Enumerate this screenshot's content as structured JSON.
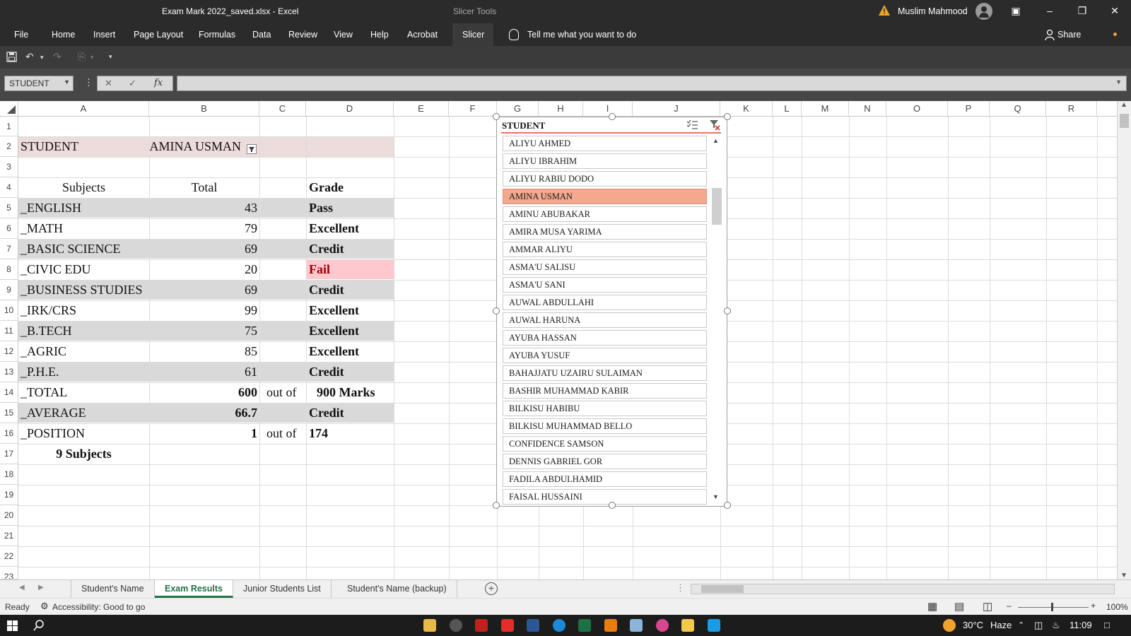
{
  "window": {
    "title": "Exam Mark 2022_saved.xlsx  -  Excel",
    "contextual_tab_group": "Slicer Tools",
    "user": "Muslim Mahmood"
  },
  "ribbon": {
    "tabs": [
      "File",
      "Home",
      "Insert",
      "Page Layout",
      "Formulas",
      "Data",
      "Review",
      "View",
      "Help",
      "Acrobat",
      "Slicer"
    ],
    "tell_me": "Tell me what you want to do",
    "share": "Share"
  },
  "formula_bar": {
    "name_box": "STUDENT",
    "fx": "fx",
    "value": ""
  },
  "columns": [
    "A",
    "B",
    "C",
    "D",
    "E",
    "F",
    "G",
    "H",
    "I",
    "J",
    "K",
    "L",
    "M",
    "N",
    "O",
    "P",
    "Q",
    "R"
  ],
  "rows": [
    "1",
    "2",
    "3",
    "4",
    "5",
    "6",
    "7",
    "8",
    "9",
    "10",
    "11",
    "12",
    "13",
    "14",
    "15",
    "16",
    "17",
    "18",
    "19",
    "20",
    "21",
    "22",
    "23"
  ],
  "sheet": {
    "student_label": "STUDENT",
    "student_name": "AMINA USMAN",
    "headers": {
      "subjects": "Subjects",
      "total": "Total",
      "grade": "Grade"
    },
    "subjects": [
      {
        "name": "_ENGLISH",
        "total": "43",
        "grade": "Pass"
      },
      {
        "name": "_MATH",
        "total": "79",
        "grade": "Excellent"
      },
      {
        "name": "_BASIC SCIENCE",
        "total": "69",
        "grade": "Credit"
      },
      {
        "name": "_CIVIC EDU",
        "total": "20",
        "grade": "Fail"
      },
      {
        "name": "_BUSINESS STUDIES",
        "total": "69",
        "grade": "Credit"
      },
      {
        "name": "_IRK/CRS",
        "total": "99",
        "grade": "Excellent"
      },
      {
        "name": "_B.TECH",
        "total": "75",
        "grade": "Excellent"
      },
      {
        "name": "_AGRIC",
        "total": "85",
        "grade": "Excellent"
      },
      {
        "name": "_P.H.E.",
        "total": "61",
        "grade": "Credit"
      }
    ],
    "total": {
      "label": "_TOTAL",
      "value": "600",
      "out_of": "out of",
      "max": "900 Marks"
    },
    "average": {
      "label": "_AVERAGE",
      "value": "66.7",
      "grade": "Credit"
    },
    "position": {
      "label": "_POSITION",
      "value": "1",
      "out_of": "out of",
      "count": "174"
    },
    "subject_count": "9 Subjects"
  },
  "slicer": {
    "title": "STUDENT",
    "items": [
      "ALIYU AHMED",
      "ALIYU IBRAHIM",
      "ALIYU RABIU DODO",
      "AMINA USMAN",
      "AMINU ABUBAKAR",
      "AMIRA MUSA YARIMA",
      "AMMAR ALIYU",
      "ASMA'U SALISU",
      "ASMA'U SANI",
      "AUWAL ABDULLAHI",
      "AUWAL HARUNA",
      "AYUBA HASSAN",
      "AYUBA YUSUF",
      "BAHAJJATU UZAIRU SULAIMAN",
      "BASHIR MUHAMMAD KABIR",
      "BILKISU HABIBU",
      "BILKISU MUHAMMAD BELLO",
      "CONFIDENCE SAMSON",
      "DENNIS GABRIEL GOR",
      "FADILA ABDULHAMID",
      "FAISAL HUSSAINI"
    ],
    "selected": "AMINA USMAN"
  },
  "sheet_tabs": [
    "Student's Name",
    "Exam Results",
    "Junior Students List",
    "Student's Name (backup)"
  ],
  "active_sheet": "Exam Results",
  "status": {
    "ready": "Ready",
    "accessibility": "Accessibility: Good to go",
    "zoom": "100%"
  },
  "taskbar": {
    "weather_temp": "30°C",
    "weather_desc": "Haze",
    "time": "11:09"
  },
  "colors": {
    "excel_green": "#217346",
    "header_band": "#ecdcdc",
    "row_band": "#d9d9d9",
    "fail_fill": "#ffc7ce",
    "fail_text": "#9c0006",
    "slicer_selected": "#f4a88d"
  }
}
